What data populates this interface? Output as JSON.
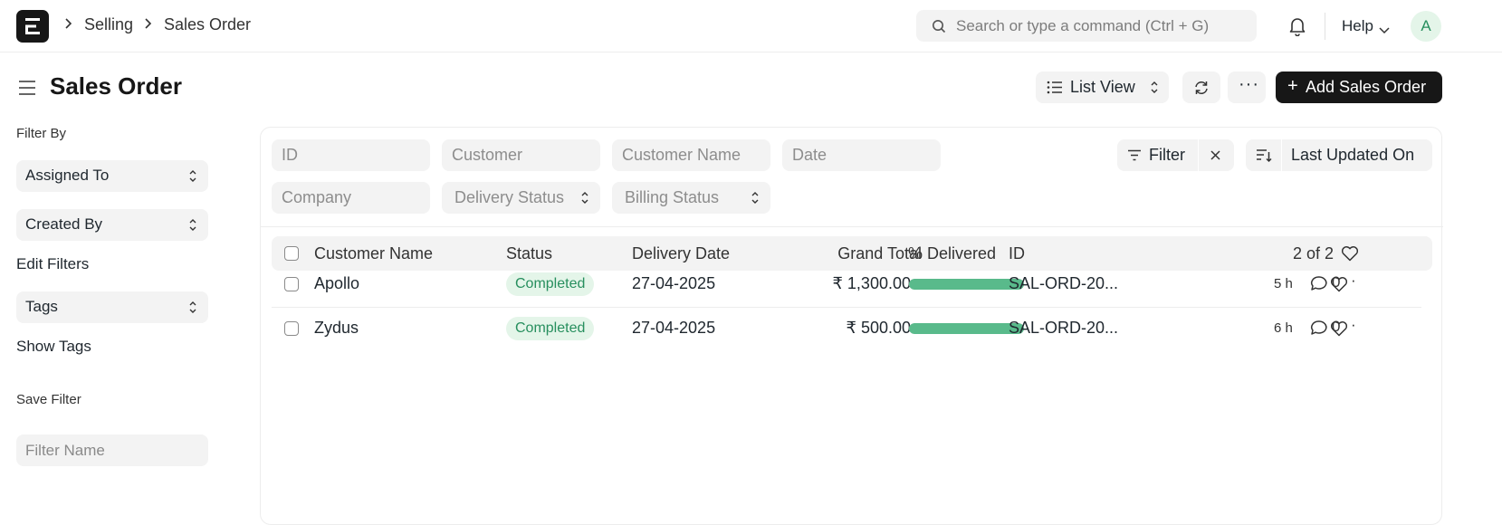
{
  "navbar": {
    "breadcrumbs": [
      "Selling",
      "Sales Order"
    ],
    "search_placeholder": "Search or type a command (Ctrl + G)",
    "help_label": "Help",
    "avatar_initial": "A"
  },
  "header": {
    "title": "Sales Order",
    "view_label": "List View",
    "more_label": "···",
    "add_label": "Add Sales Order"
  },
  "sidebar": {
    "filter_by_label": "Filter By",
    "assigned_to": "Assigned To",
    "created_by": "Created By",
    "edit_filters": "Edit Filters",
    "tags": "Tags",
    "show_tags": "Show Tags",
    "save_filter_label": "Save Filter",
    "filter_name_placeholder": "Filter Name"
  },
  "filters": {
    "id": "ID",
    "customer": "Customer",
    "customer_name": "Customer Name",
    "date": "Date",
    "company": "Company",
    "delivery_status": "Delivery Status",
    "billing_status": "Billing Status",
    "filter_label": "Filter",
    "sort_label": "Last Updated On"
  },
  "list": {
    "columns": {
      "customer_name": "Customer Name",
      "status": "Status",
      "delivery_date": "Delivery Date",
      "grand_total": "Grand Total",
      "delivered": "% Delivered",
      "id": "ID"
    },
    "count": "2 of 2",
    "rows": [
      {
        "customer": "Apollo",
        "status": "Completed",
        "delivery_date": "27-04-2025",
        "grand_total": "₹ 1,300.00",
        "delivered_pct": 100,
        "id": "SAL-ORD-20...",
        "modified": "5 h",
        "comments": "0"
      },
      {
        "customer": "Zydus",
        "status": "Completed",
        "delivery_date": "27-04-2025",
        "grand_total": "₹ 500.00",
        "delivered_pct": 100,
        "id": "SAL-ORD-20...",
        "modified": "6 h",
        "comments": "0"
      }
    ]
  },
  "colors": {
    "primary": "#171717",
    "success_bg": "#e4f5e9",
    "success_text": "#278f5e",
    "progress_fill": "#59ba8b"
  }
}
